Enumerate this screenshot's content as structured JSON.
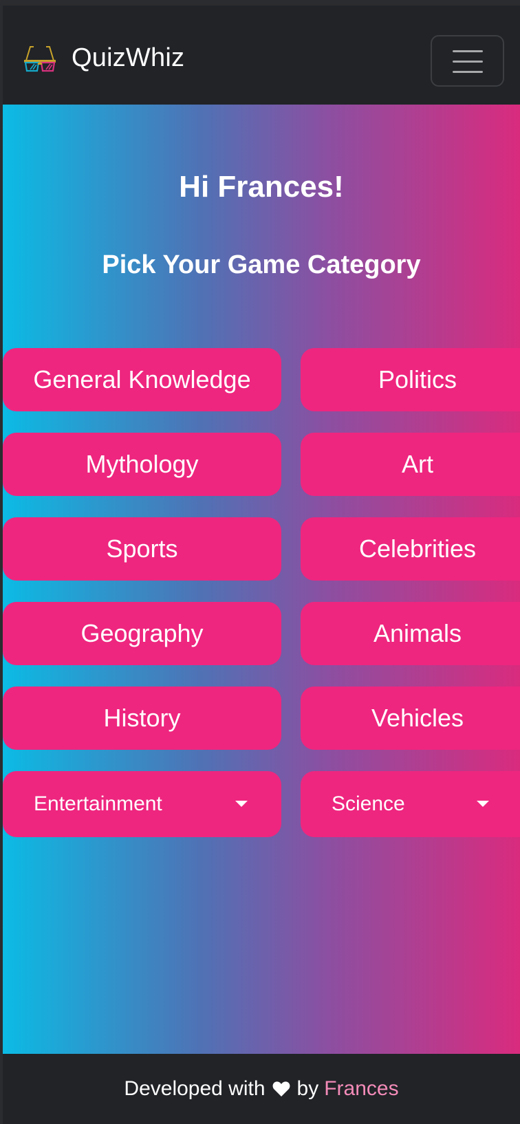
{
  "navbar": {
    "brand_name": "QuizWhiz",
    "brand_icon": "3d-glasses-icon",
    "toggler_icon": "hamburger-menu-icon"
  },
  "hero": {
    "greeting": "Hi Frances!",
    "subheading": "Pick Your Game Category",
    "gradient_colors": [
      "#0bbbe4",
      "#4f72b5",
      "#8a50a2",
      "#d92b7e"
    ]
  },
  "categories": [
    "General Knowledge",
    "Politics",
    "Mythology",
    "Art",
    "Sports",
    "Celebrities",
    "Geography",
    "Animals",
    "History",
    "Vehicles"
  ],
  "dropdowns": [
    {
      "label": "Entertainment",
      "icon": "caret-down-icon"
    },
    {
      "label": "Science",
      "icon": "caret-down-icon"
    }
  ],
  "footer": {
    "prefix": "Developed with",
    "heart_icon": "heart-icon",
    "middle": "by",
    "author": "Frances"
  },
  "colors": {
    "navbar_bg": "#212327",
    "button_bg": "#ee267f",
    "footer_link": "#f38bb8",
    "text": "#ffffff"
  }
}
